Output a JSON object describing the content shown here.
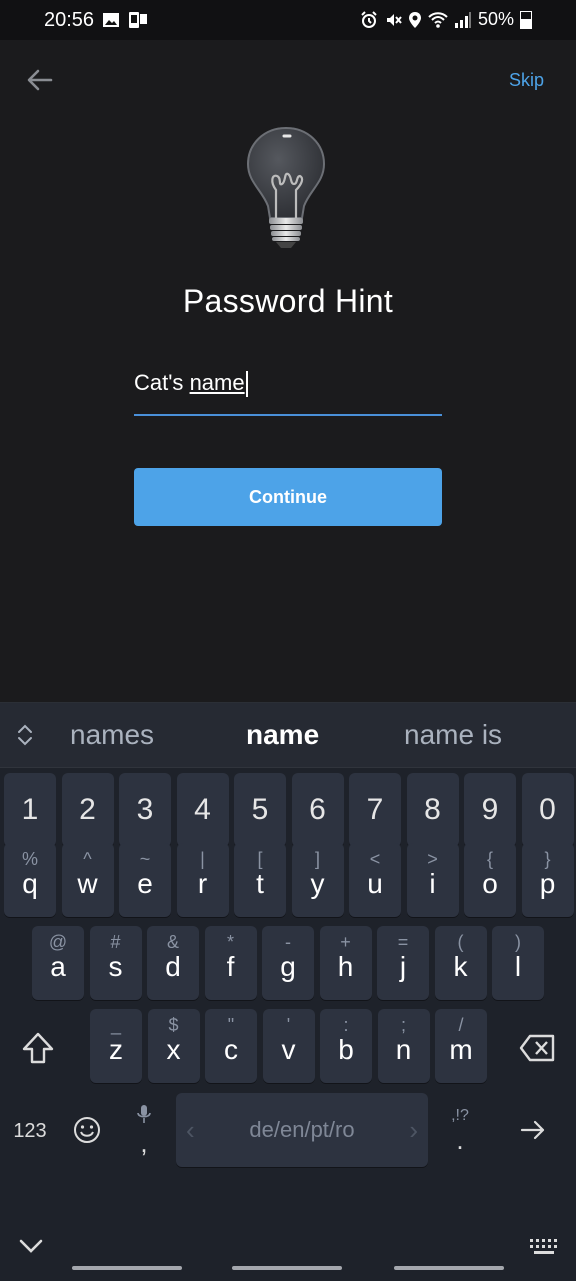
{
  "status_bar": {
    "time": "20:56",
    "battery": "50%"
  },
  "header": {
    "skip_label": "Skip"
  },
  "main": {
    "title": "Password Hint",
    "hint_prefix": "Cat's ",
    "hint_underlined": "name",
    "continue_label": "Continue"
  },
  "keyboard": {
    "suggestions": [
      "names",
      "name",
      "name is"
    ],
    "numbers": [
      "1",
      "2",
      "3",
      "4",
      "5",
      "6",
      "7",
      "8",
      "9",
      "0"
    ],
    "row1": [
      {
        "k": "q",
        "s": "%"
      },
      {
        "k": "w",
        "s": "^"
      },
      {
        "k": "e",
        "s": "~"
      },
      {
        "k": "r",
        "s": "|"
      },
      {
        "k": "t",
        "s": "["
      },
      {
        "k": "y",
        "s": "]"
      },
      {
        "k": "u",
        "s": "<"
      },
      {
        "k": "i",
        "s": ">"
      },
      {
        "k": "o",
        "s": "{"
      },
      {
        "k": "p",
        "s": "}"
      }
    ],
    "row2": [
      {
        "k": "a",
        "s": "@"
      },
      {
        "k": "s",
        "s": "#"
      },
      {
        "k": "d",
        "s": "&"
      },
      {
        "k": "f",
        "s": "*"
      },
      {
        "k": "g",
        "s": "-"
      },
      {
        "k": "h",
        "s": "+"
      },
      {
        "k": "j",
        "s": "="
      },
      {
        "k": "k",
        "s": "("
      },
      {
        "k": "l",
        "s": ")"
      }
    ],
    "row3": [
      {
        "k": "z",
        "s": "_"
      },
      {
        "k": "x",
        "s": "$"
      },
      {
        "k": "c",
        "s": "\""
      },
      {
        "k": "v",
        "s": "'"
      },
      {
        "k": "b",
        "s": ":"
      },
      {
        "k": "n",
        "s": ";"
      },
      {
        "k": "m",
        "s": "/"
      }
    ],
    "mode_label": "123",
    "comma": ",",
    "space_label": "de/en/pt/ro",
    "period": ".",
    "period_hint": ",!?"
  }
}
